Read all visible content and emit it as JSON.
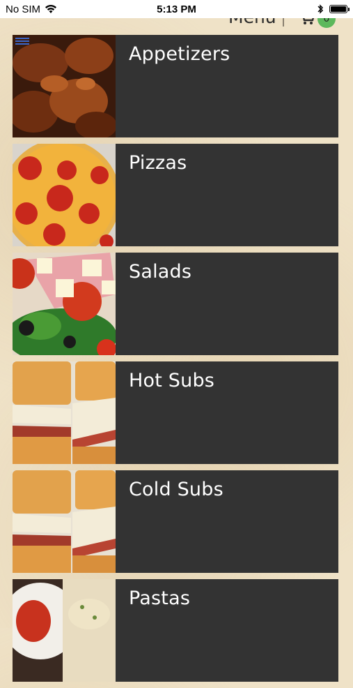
{
  "status_bar": {
    "carrier": "No SIM",
    "time": "5:13 PM",
    "icons": [
      "wifi-icon",
      "bluetooth-icon",
      "battery-icon"
    ]
  },
  "header": {
    "title": "Menu",
    "cart_count": "0",
    "icons": [
      "hamburger-icon",
      "cart-icon"
    ]
  },
  "categories": [
    {
      "label": "Appetizers",
      "image": "chicken-wings"
    },
    {
      "label": "Pizzas",
      "image": "pepperoni-pizza"
    },
    {
      "label": "Salads",
      "image": "antipasto-salad"
    },
    {
      "label": "Hot Subs",
      "image": "sub-sandwich"
    },
    {
      "label": "Cold Subs",
      "image": "sub-sandwich"
    },
    {
      "label": "Pastas",
      "image": "pasta"
    }
  ],
  "colors": {
    "panel": "#333333",
    "background": "#efe2c7",
    "badge": "#5cb85c",
    "hamburger": "#3b67c9"
  }
}
